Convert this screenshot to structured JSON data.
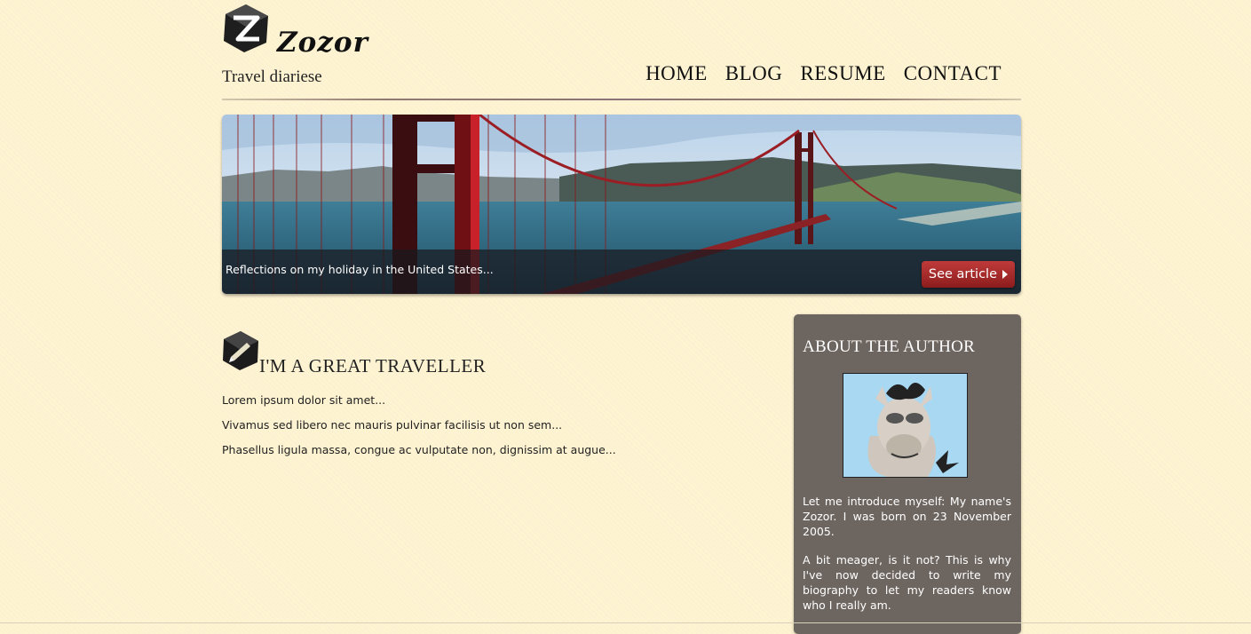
{
  "header": {
    "logo_text": "Zozor",
    "tagline": "Travel diariese",
    "nav": [
      "HOME",
      "BLOG",
      "RESUME",
      "CONTACT"
    ]
  },
  "banner": {
    "caption": "Reflections on my holiday in the United States...",
    "button_label": "See article"
  },
  "post": {
    "title": "I'M A GREAT TRAVELLER",
    "paragraphs": [
      "Lorem ipsum dolor sit amet...",
      "Vivamus sed libero nec mauris pulvinar facilisis ut non sem...",
      "Phasellus ligula massa, congue ac vulputate non, dignissim at augue..."
    ]
  },
  "sidebar": {
    "title": "ABOUT THE AUTHOR",
    "paragraphs": [
      "Let me introduce myself: My name's Zozor. I was born on 23 November 2005.",
      "A bit meager, is it not? This is why I've now decided to write my biography to let my readers know who I really am."
    ]
  },
  "colors": {
    "background": "#fff4d2",
    "sidebar": "#6d6560",
    "button": "#a52a2a"
  }
}
